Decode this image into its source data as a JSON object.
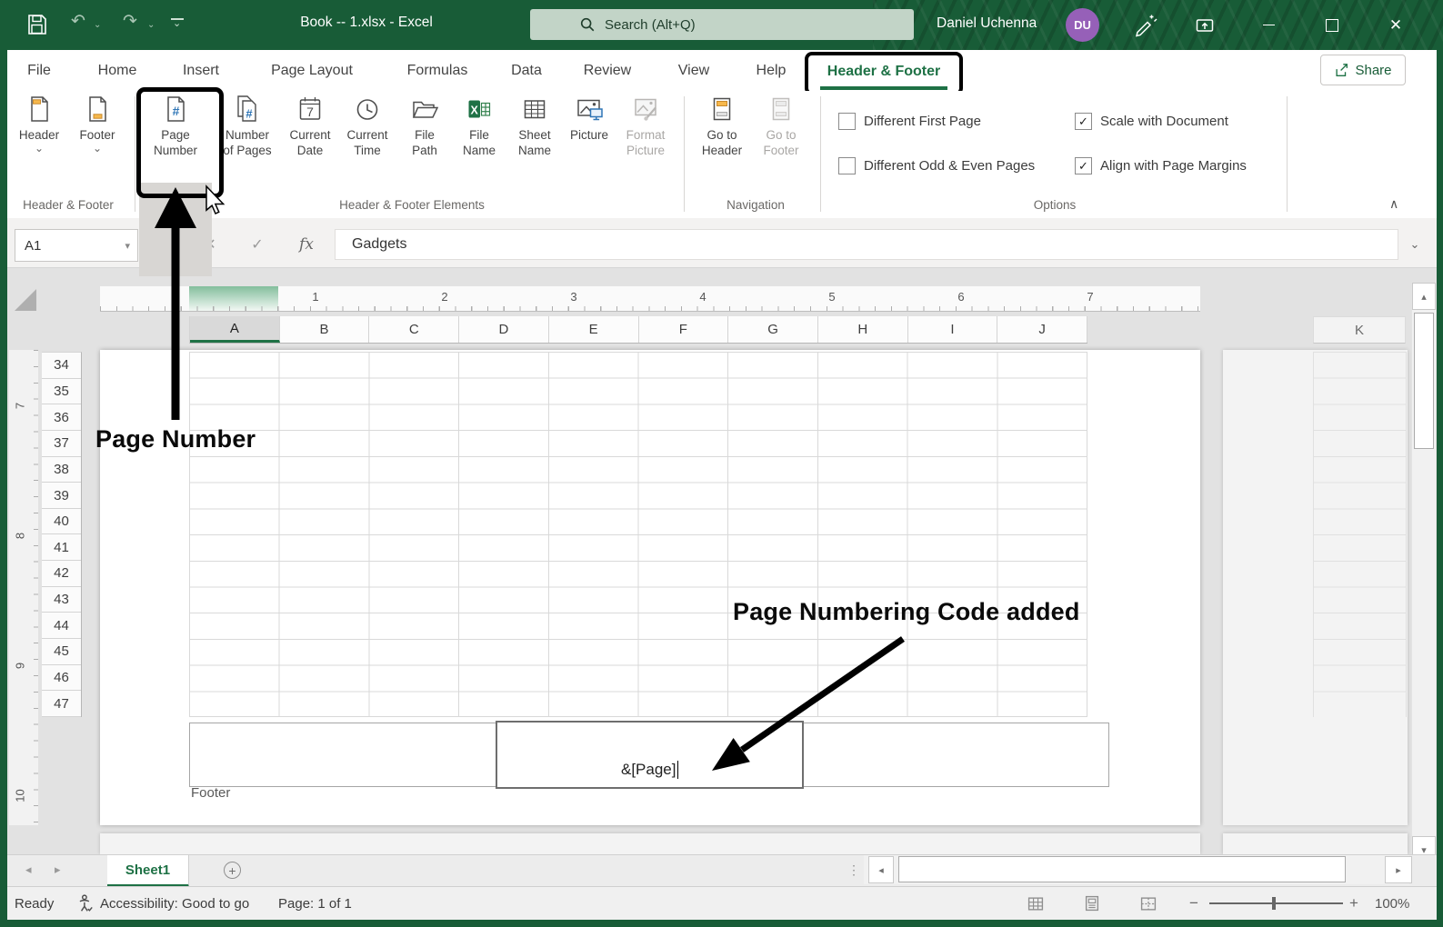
{
  "titlebar": {
    "title": "Book -- 1.xlsx - Excel",
    "search_placeholder": "Search (Alt+Q)",
    "user_name": "Daniel Uchenna",
    "user_initials": "DU"
  },
  "tabs": [
    {
      "label": "File"
    },
    {
      "label": "Home"
    },
    {
      "label": "Insert"
    },
    {
      "label": "Page Layout"
    },
    {
      "label": "Formulas"
    },
    {
      "label": "Data"
    },
    {
      "label": "Review"
    },
    {
      "label": "View"
    },
    {
      "label": "Help"
    },
    {
      "label": "Header & Footer",
      "active": true
    }
  ],
  "share": {
    "label": "Share"
  },
  "ribbon": {
    "header": {
      "label": "Header"
    },
    "footer": {
      "label": "Footer"
    },
    "elements": [
      {
        "label1": "Page",
        "label2": "Number"
      },
      {
        "label1": "Number",
        "label2": "of Pages"
      },
      {
        "label1": "Current",
        "label2": "Date"
      },
      {
        "label1": "Current",
        "label2": "Time"
      },
      {
        "label1": "File",
        "label2": "Path"
      },
      {
        "label1": "File",
        "label2": "Name"
      },
      {
        "label1": "Sheet",
        "label2": "Name"
      },
      {
        "label1": "Picture",
        "label2": ""
      },
      {
        "label1": "Format",
        "label2": "Picture"
      }
    ],
    "navigation": [
      {
        "label1": "Go to",
        "label2": "Header"
      },
      {
        "label1": "Go to",
        "label2": "Footer"
      }
    ],
    "options": [
      {
        "label": "Different First Page",
        "checked": false
      },
      {
        "label": "Different Odd & Even Pages",
        "checked": false
      },
      {
        "label": "Scale with Document",
        "checked": true
      },
      {
        "label": "Align with Page Margins",
        "checked": true
      }
    ],
    "group_labels": [
      "Header & Footer",
      "Header & Footer Elements",
      "Navigation",
      "Options"
    ]
  },
  "formula_bar": {
    "cell_ref": "A1",
    "value": "Gadgets"
  },
  "sheet": {
    "columns": [
      "A",
      "B",
      "C",
      "D",
      "E",
      "F",
      "G",
      "H",
      "I",
      "J",
      "K"
    ],
    "rows": [
      "34",
      "35",
      "36",
      "37",
      "38",
      "39",
      "40",
      "41",
      "42",
      "43",
      "44",
      "45",
      "46",
      "47"
    ],
    "h_ruler": [
      "1",
      "2",
      "3",
      "4",
      "5",
      "6",
      "7"
    ],
    "v_ruler": [
      "7",
      "8",
      "9",
      "10"
    ]
  },
  "footer_area": {
    "code": "&[Page]",
    "label": "Footer"
  },
  "annotations": {
    "page_number": "Page Number",
    "code_added": "Page Numbering Code added"
  },
  "sheetbar": {
    "active_tab": "Sheet1"
  },
  "statusbar": {
    "mode": "Ready",
    "accessibility": "Accessibility: Good to go",
    "page": "Page: 1 of 1",
    "zoom": "100%"
  },
  "icons": {
    "chevron_down": "⌄",
    "dropdown": "▾",
    "undo": "↶",
    "redo": "↷",
    "close": "✕",
    "cancel": "✕",
    "check": "✓",
    "fx": "fx",
    "ellipsis": "⋮",
    "tri_left": "◂",
    "tri_right": "▸",
    "tri_up": "▴",
    "tri_down": "▾",
    "plus": "+",
    "minus": "−",
    "collapse": "∧"
  }
}
